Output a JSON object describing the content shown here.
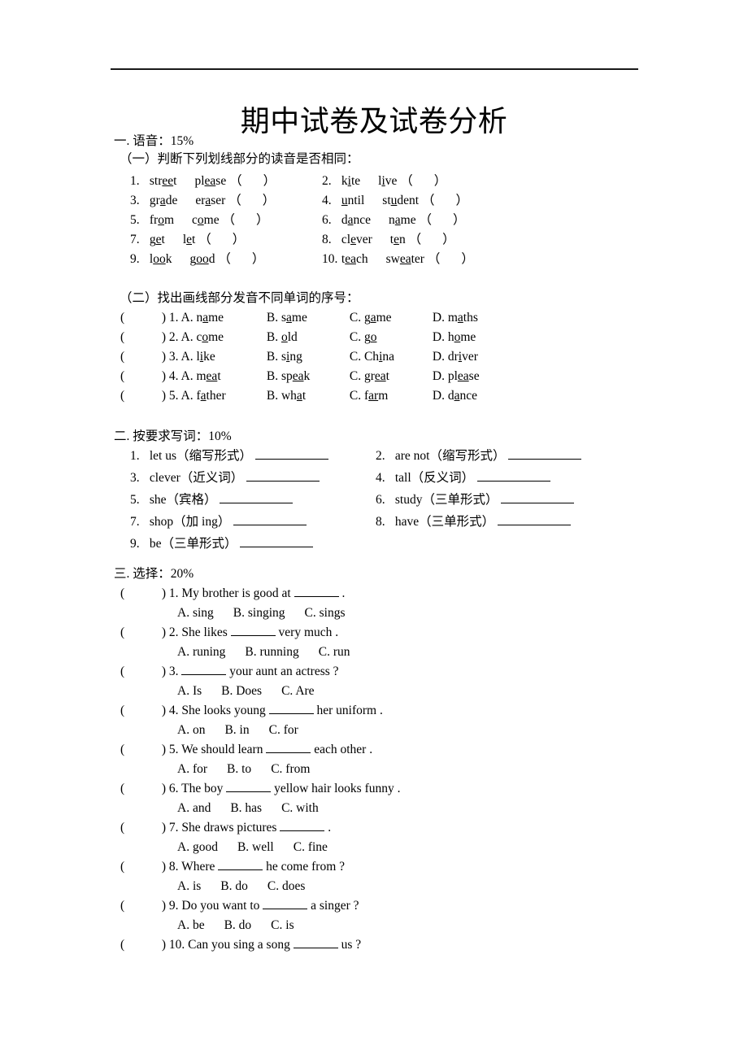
{
  "document": {
    "title": "期中试卷及试卷分析"
  },
  "sections": [
    {
      "heading": "一. 语音：15%",
      "subsections": [
        {
          "heading": "（一）判断下列划线部分的读音是否相同：",
          "items": [
            {
              "num": "1.",
              "w1_a": "str",
              "w1_u": "ee",
              "w1_b": "t",
              "w2_a": "pl",
              "w2_u": "ea",
              "w2_b": "se"
            },
            {
              "num": "2.",
              "w1_a": "k",
              "w1_u": "i",
              "w1_b": "te",
              "w2_a": "l",
              "w2_u": "i",
              "w2_b": "ve"
            },
            {
              "num": "3.",
              "w1_a": "gr",
              "w1_u": "a",
              "w1_b": "de",
              "w2_a": "er",
              "w2_u": "a",
              "w2_b": "ser"
            },
            {
              "num": "4.",
              "w1_a": "",
              "w1_u": "u",
              "w1_b": "ntil",
              "w2_a": "st",
              "w2_u": "u",
              "w2_b": "dent"
            },
            {
              "num": "5.",
              "w1_a": "fr",
              "w1_u": "o",
              "w1_b": "m",
              "w2_a": "c",
              "w2_u": "o",
              "w2_b": "me"
            },
            {
              "num": "6.",
              "w1_a": "d",
              "w1_u": "a",
              "w1_b": "nce",
              "w2_a": "n",
              "w2_u": "a",
              "w2_b": "me"
            },
            {
              "num": "7.",
              "w1_a": "g",
              "w1_u": "e",
              "w1_b": "t",
              "w2_a": "l",
              "w2_u": "e",
              "w2_b": "t"
            },
            {
              "num": "8.",
              "w1_a": "cl",
              "w1_u": "e",
              "w1_b": "ver",
              "w2_a": "t",
              "w2_u": "e",
              "w2_b": "n"
            },
            {
              "num": "9.",
              "w1_a": "l",
              "w1_u": "oo",
              "w1_b": "k",
              "w2_a": "g",
              "w2_u": "oo",
              "w2_b": "d"
            },
            {
              "num": "10.",
              "w1_a": "t",
              "w1_u": "ea",
              "w1_b": "ch",
              "w2_a": "sw",
              "w2_u": "ea",
              "w2_b": "ter"
            }
          ]
        },
        {
          "heading": "（二）找出画线部分发音不同单词的序号：",
          "items": [
            {
              "num": "1.",
              "options": [
                {
                  "letter": "A.",
                  "a": "n",
                  "u": "a",
                  "b": "me"
                },
                {
                  "letter": "B.",
                  "a": "s",
                  "u": "a",
                  "b": "me"
                },
                {
                  "letter": "C.",
                  "a": "g",
                  "u": "a",
                  "b": "me"
                },
                {
                  "letter": "D.",
                  "a": "m",
                  "u": "a",
                  "b": "ths"
                }
              ]
            },
            {
              "num": "2.",
              "options": [
                {
                  "letter": "A.",
                  "a": "c",
                  "u": "o",
                  "b": "me"
                },
                {
                  "letter": "B.",
                  "a": "",
                  "u": "o",
                  "b": "ld"
                },
                {
                  "letter": "C.",
                  "a": "g",
                  "u": "o",
                  "b": ""
                },
                {
                  "letter": "D.",
                  "a": "h",
                  "u": "o",
                  "b": "me"
                }
              ]
            },
            {
              "num": "3.",
              "options": [
                {
                  "letter": "A.",
                  "a": "l",
                  "u": "i",
                  "b": "ke"
                },
                {
                  "letter": "B.",
                  "a": "s",
                  "u": "i",
                  "b": "ng"
                },
                {
                  "letter": "C.",
                  "a": "Ch",
                  "u": "i",
                  "b": "na"
                },
                {
                  "letter": "D.",
                  "a": "dr",
                  "u": "i",
                  "b": "ver"
                }
              ]
            },
            {
              "num": "4.",
              "options": [
                {
                  "letter": "A.",
                  "a": "m",
                  "u": "ea",
                  "b": "t"
                },
                {
                  "letter": "B.",
                  "a": "sp",
                  "u": "ea",
                  "b": "k"
                },
                {
                  "letter": "C.",
                  "a": "gr",
                  "u": "ea",
                  "b": "t"
                },
                {
                  "letter": "D.",
                  "a": "pl",
                  "u": "ea",
                  "b": "se"
                }
              ]
            },
            {
              "num": "5.",
              "options": [
                {
                  "letter": "A.",
                  "a": "f",
                  "u": "a",
                  "b": "ther"
                },
                {
                  "letter": "B.",
                  "a": "wh",
                  "u": "a",
                  "b": "t"
                },
                {
                  "letter": "C.",
                  "a": "f",
                  "u": "ar",
                  "b": "m"
                },
                {
                  "letter": "D.",
                  "a": "d",
                  "u": "a",
                  "b": "nce"
                }
              ]
            }
          ]
        }
      ]
    },
    {
      "heading": "二. 按要求写词：10%",
      "items": [
        {
          "num": "1.",
          "text": "let us（缩写形式）"
        },
        {
          "num": "2.",
          "text": "are not（缩写形式）"
        },
        {
          "num": "3.",
          "text": "clever（近义词）"
        },
        {
          "num": "4.",
          "text": "tall（反义词）"
        },
        {
          "num": "5.",
          "text": "she（宾格）"
        },
        {
          "num": "6.",
          "text": "study（三单形式）"
        },
        {
          "num": "7.",
          "text": "shop（加 ing）"
        },
        {
          "num": "8.",
          "text": "have（三单形式）"
        },
        {
          "num": "9.",
          "text": "be（三单形式）"
        }
      ]
    },
    {
      "heading": "三. 选择：20%",
      "questions": [
        {
          "num": "1.",
          "pre": "My brother is good at",
          "post": ".",
          "options": [
            "A. sing",
            "B. singing",
            "C. sings"
          ]
        },
        {
          "num": "2.",
          "pre": "She likes",
          "post": "very much .",
          "options": [
            "A. runing",
            "B. running",
            "C. run"
          ]
        },
        {
          "num": "3.",
          "pre": "",
          "post": "your aunt an actress ?",
          "options": [
            "A. Is",
            "B. Does",
            "C. Are"
          ]
        },
        {
          "num": "4.",
          "pre": "She looks young",
          "post": "her uniform .",
          "options": [
            "A. on",
            "B. in",
            "C. for"
          ]
        },
        {
          "num": "5.",
          "pre": "We should learn",
          "post": "each other .",
          "options": [
            "A. for",
            "B. to",
            "C. from"
          ]
        },
        {
          "num": "6.",
          "pre": "The boy",
          "post": "yellow hair looks funny .",
          "options": [
            "A. and",
            "B. has",
            "C. with"
          ]
        },
        {
          "num": "7.",
          "pre": "She draws pictures",
          "post": ".",
          "options": [
            "A. good",
            "B. well",
            "C. fine"
          ]
        },
        {
          "num": "8.",
          "pre": "Where",
          "post": "he come from ?",
          "options": [
            "A. is",
            "B. do",
            "C. does"
          ]
        },
        {
          "num": "9.",
          "pre": "Do you want to",
          "post": "a singer ?",
          "options": [
            "A. be",
            "B. do",
            "C. is"
          ]
        },
        {
          "num": "10.",
          "pre": "Can you sing a song",
          "post": "us ?",
          "options": []
        }
      ]
    }
  ],
  "glyphs": {
    "paren_open": "（",
    "paren_close": "）",
    "ascii_paren_open": "(",
    "ascii_paren_close": ")"
  }
}
